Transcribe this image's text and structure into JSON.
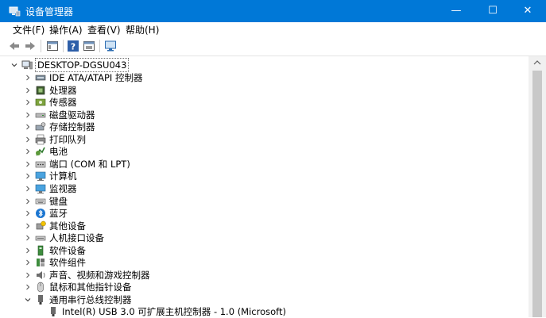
{
  "window": {
    "title": "设备管理器",
    "accent": "#0078d7",
    "minimize": "—",
    "maximize": "☐",
    "close": "✕"
  },
  "menu": [
    "文件(F)",
    "操作(A)",
    "查看(V)",
    "帮助(H)"
  ],
  "toolbar": [
    "back-icon",
    "forward-icon",
    "properties-icon",
    "help-icon",
    "update-driver-icon",
    "monitor-scan-icon"
  ],
  "tree": {
    "root": "DESKTOP-DGSU043",
    "items": [
      {
        "label": "IDE ATA/ATAPI 控制器",
        "icon": "ide-controller-icon"
      },
      {
        "label": "处理器",
        "icon": "processor-icon"
      },
      {
        "label": "传感器",
        "icon": "sensor-icon"
      },
      {
        "label": "磁盘驱动器",
        "icon": "disk-drive-icon"
      },
      {
        "label": "存储控制器",
        "icon": "storage-controller-icon"
      },
      {
        "label": "打印队列",
        "icon": "printer-icon"
      },
      {
        "label": "电池",
        "icon": "battery-icon"
      },
      {
        "label": "端口 (COM 和 LPT)",
        "icon": "port-icon"
      },
      {
        "label": "计算机",
        "icon": "computer-icon"
      },
      {
        "label": "监视器",
        "icon": "monitor-icon"
      },
      {
        "label": "键盘",
        "icon": "keyboard-icon"
      },
      {
        "label": "蓝牙",
        "icon": "bluetooth-icon"
      },
      {
        "label": "其他设备",
        "icon": "other-devices-icon"
      },
      {
        "label": "人机接口设备",
        "icon": "hid-icon"
      },
      {
        "label": "软件设备",
        "icon": "software-device-icon"
      },
      {
        "label": "软件组件",
        "icon": "software-component-icon"
      },
      {
        "label": "声音、视频和游戏控制器",
        "icon": "audio-icon"
      },
      {
        "label": "鼠标和其他指针设备",
        "icon": "mouse-icon"
      },
      {
        "label": "通用串行总线控制器",
        "icon": "usb-controller-icon",
        "expanded": true
      }
    ],
    "child": {
      "label": "Intel(R) USB 3.0 可扩展主机控制器 - 1.0 (Microsoft)",
      "icon": "usb-device-icon"
    }
  }
}
